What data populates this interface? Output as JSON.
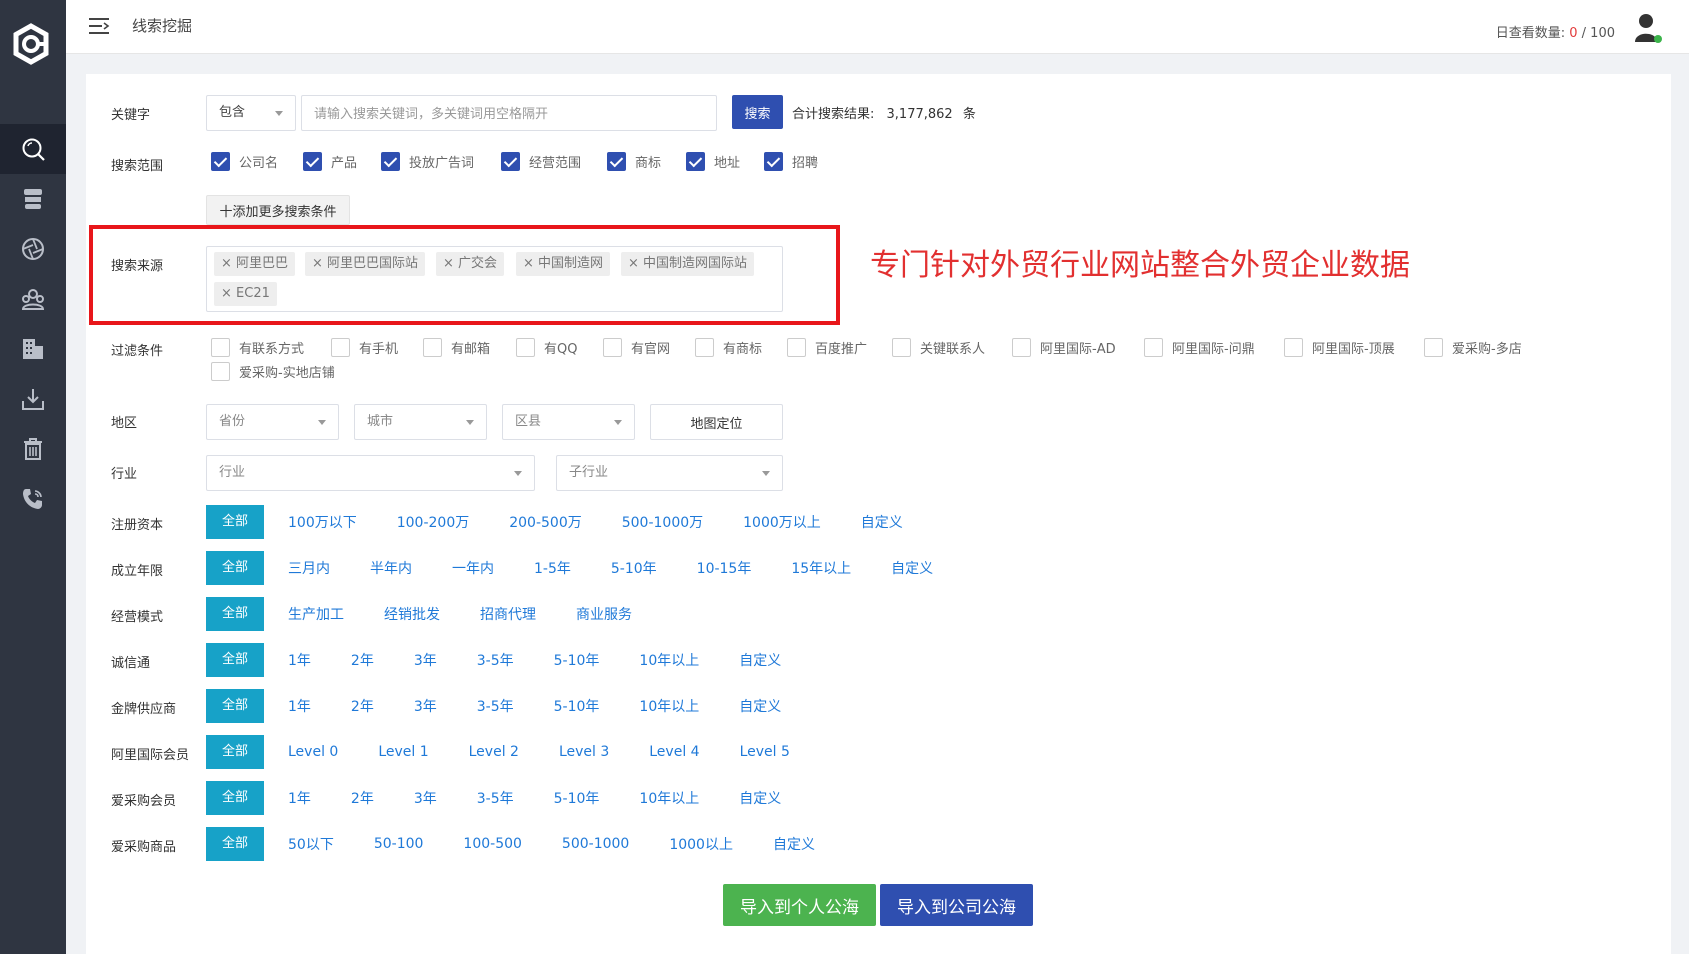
{
  "header": {
    "title": "线索挖掘",
    "quota_label": "日查看数量:",
    "quota_used": "0",
    "quota_total": "/ 100"
  },
  "sidebar": {
    "items": [
      {
        "icon": "search-icon"
      },
      {
        "icon": "database-icon"
      },
      {
        "icon": "aperture-icon"
      },
      {
        "icon": "group-icon"
      },
      {
        "icon": "building-icon"
      },
      {
        "icon": "download-icon"
      },
      {
        "icon": "trash-icon"
      },
      {
        "icon": "phone-icon"
      }
    ]
  },
  "keyword": {
    "label": "关键字",
    "mode": "包含",
    "placeholder": "请输入搜索关键词，多关键词用空格隔开",
    "search_button": "搜索",
    "result_label": "合计搜索结果:",
    "result_count": "3,177,862",
    "result_unit": "条"
  },
  "scope": {
    "label": "搜索范围",
    "options": [
      "公司名",
      "产品",
      "投放广告词",
      "经营范围",
      "商标",
      "地址",
      "招聘"
    ],
    "add_button": "十添加更多搜索条件"
  },
  "source": {
    "label": "搜索来源",
    "tags": [
      "× 阿里巴巴",
      "× 阿里巴巴国际站",
      "× 广交会",
      "× 中国制造网",
      "× 中国制造网国际站",
      "× EC21"
    ]
  },
  "annotation": "专门针对外贸行业网站整合外贸企业数据",
  "filter": {
    "label": "过滤条件",
    "options": [
      "有联系方式",
      "有手机",
      "有邮箱",
      "有QQ",
      "有官网",
      "有商标",
      "百度推广",
      "关键联系人",
      "阿里国际-AD",
      "阿里国际-问鼎",
      "阿里国际-顶展",
      "爱采购-多店",
      "爱采购-实地店铺"
    ]
  },
  "region": {
    "label": "地区",
    "province": "省份",
    "city": "城市",
    "district": "区县",
    "map_button": "地图定位"
  },
  "industry": {
    "label": "行业",
    "industry": "行业",
    "sub_industry": "子行业"
  },
  "rows": [
    {
      "label": "注册资本",
      "options": [
        "全部",
        "100万以下",
        "100-200万",
        "200-500万",
        "500-1000万",
        "1000万以上",
        "自定义"
      ]
    },
    {
      "label": "成立年限",
      "options": [
        "全部",
        "三月内",
        "半年内",
        "一年内",
        "1-5年",
        "5-10年",
        "10-15年",
        "15年以上",
        "自定义"
      ]
    },
    {
      "label": "经营模式",
      "options": [
        "全部",
        "生产加工",
        "经销批发",
        "招商代理",
        "商业服务"
      ]
    },
    {
      "label": "诚信通",
      "options": [
        "全部",
        "1年",
        "2年",
        "3年",
        "3-5年",
        "5-10年",
        "10年以上",
        "自定义"
      ]
    },
    {
      "label": "金牌供应商",
      "options": [
        "全部",
        "1年",
        "2年",
        "3年",
        "3-5年",
        "5-10年",
        "10年以上",
        "自定义"
      ]
    },
    {
      "label": "阿里国际会员",
      "options": [
        "全部",
        "Level 0",
        "Level 1",
        "Level 2",
        "Level 3",
        "Level 4",
        "Level 5"
      ]
    },
    {
      "label": "爱采购会员",
      "options": [
        "全部",
        "1年",
        "2年",
        "3年",
        "3-5年",
        "5-10年",
        "10年以上",
        "自定义"
      ]
    },
    {
      "label": "爱采购商品",
      "options": [
        "全部",
        "50以下",
        "50-100",
        "100-500",
        "500-1000",
        "1000以上",
        "自定义"
      ]
    }
  ],
  "actions": {
    "import_personal": "导入到个人公海",
    "import_company": "导入到公司公海"
  },
  "colors": {
    "sidebar": "#2f3541",
    "primary": "#2f4fb0",
    "active_option": "#17a2c8",
    "link": "#1f79d8",
    "green": "#4cb34f",
    "highlight": "#e8161a"
  }
}
